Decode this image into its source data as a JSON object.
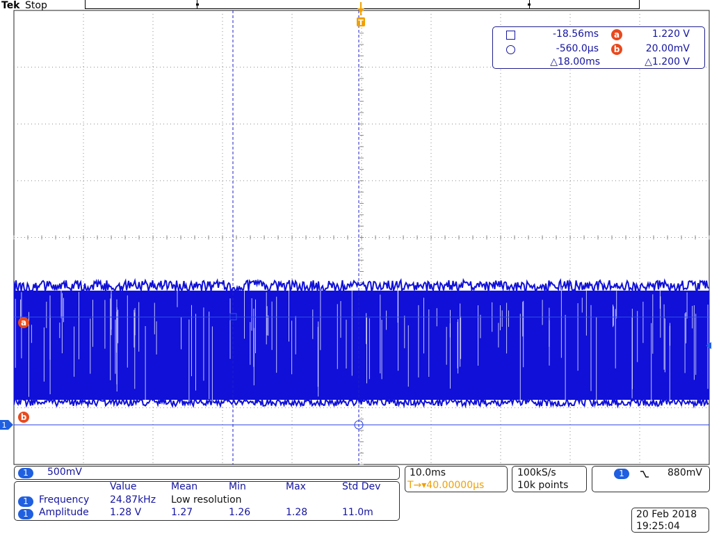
{
  "topbar": {
    "brand": "Tek",
    "acq_state": "Stop"
  },
  "cursor_readout": {
    "t1": "-18.56ms",
    "t2": "-560.0µs",
    "delta_t": "△18.00ms",
    "a_label": "a",
    "a_value": "1.220 V",
    "b_label": "b",
    "b_value": "20.00mV",
    "delta_v": "△1.200 V"
  },
  "markers": {
    "cursor_a": "a",
    "cursor_b": "b",
    "channel1": "1",
    "trigger": "T"
  },
  "channel": {
    "number": "1",
    "scale": "500mV"
  },
  "timebase": {
    "scale": "10.0ms",
    "trigger_pos": "T→▾40.00000µs"
  },
  "acquisition": {
    "rate": "100kS/s",
    "record_length": "10k points"
  },
  "trigger": {
    "source": "1",
    "slope_icon": "falling-edge-icon",
    "level": "880mV"
  },
  "measurements": {
    "headers": [
      "Value",
      "Mean",
      "Min",
      "Max",
      "Std Dev"
    ],
    "rows": [
      {
        "ch": "1",
        "name": "Frequency",
        "value": "24.87kHz",
        "mean": "Low resolution",
        "min": "",
        "max": "",
        "std": ""
      },
      {
        "ch": "1",
        "name": "Amplitude",
        "value": "1.28 V",
        "mean": "1.27",
        "min": "1.26",
        "max": "1.28",
        "std": "11.0m"
      }
    ]
  },
  "datetime": {
    "date": "20 Feb  2018",
    "time": "19:25:04"
  },
  "colors": {
    "trace": "#1010d8",
    "cursor": "#1e1ecc",
    "accent": "#e8491d",
    "trigger": "#f0a000"
  }
}
